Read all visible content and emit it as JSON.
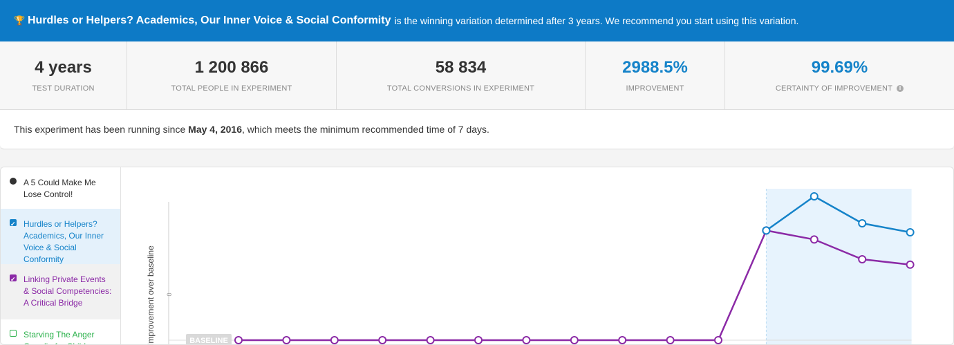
{
  "banner": {
    "winner_name": "Hurdles or Helpers? Academics, Our Inner Voice & Social Conformity",
    "message": "is the winning variation determined after 3 years. We recommend you start using this variation."
  },
  "stats": [
    {
      "value": "4 years",
      "label": "TEST DURATION",
      "accent": false
    },
    {
      "value": "1 200 866",
      "label": "TOTAL PEOPLE IN EXPERIMENT",
      "accent": false
    },
    {
      "value": "58 834",
      "label": "TOTAL CONVERSIONS IN EXPERIMENT",
      "accent": false
    },
    {
      "value": "2988.5%",
      "label": "IMPROVEMENT",
      "accent": true
    },
    {
      "value": "99.69%",
      "label": "CERTAINTY OF IMPROVEMENT",
      "accent": true
    }
  ],
  "note": {
    "prefix": "This experiment has been running since",
    "date": "May 4, 2016",
    "suffix": ", which meets the minimum recommended time of 7 days."
  },
  "variations": [
    {
      "label": "A 5 Could Make Me Lose Control!",
      "color": "#333333",
      "checked": false
    },
    {
      "label": "Hurdles or Helpers? Academics, Our Inner Voice & Social Conformity",
      "color": "#1583c9",
      "checked": true
    },
    {
      "label": "Linking Private Events & Social Competencies: A Critical Bridge",
      "color": "#8b2aa6",
      "checked": true
    },
    {
      "label": "Starving The Anger Gremlin for Children",
      "color": "#2bb14b",
      "checked": false
    }
  ],
  "chart_data": {
    "type": "line",
    "ylabel": "Improvement over baseline",
    "ytick": "0",
    "baseline_label": "BASELINE",
    "x": [
      1,
      2,
      3,
      4,
      5,
      6,
      7,
      8,
      9,
      10,
      11,
      12,
      13,
      14,
      15
    ],
    "series": [
      {
        "name": "Linking Private Events & Social Competencies: A Critical Bridge",
        "color": "#8b2aa6",
        "values": [
          0,
          0,
          0,
          0,
          0,
          0,
          0,
          0,
          0,
          0,
          0,
          1.22,
          1.12,
          0.9,
          0.84
        ]
      },
      {
        "name": "Hurdles or Helpers? Academics, Our Inner Voice & Social Conformity",
        "color": "#1583c9",
        "values": [
          null,
          null,
          null,
          null,
          null,
          null,
          null,
          null,
          null,
          null,
          null,
          1.22,
          1.6,
          1.3,
          1.2
        ]
      }
    ],
    "highlight_from_index": 11
  },
  "colors": {
    "banner": "#0d7ac6",
    "accent": "#1583c9"
  }
}
